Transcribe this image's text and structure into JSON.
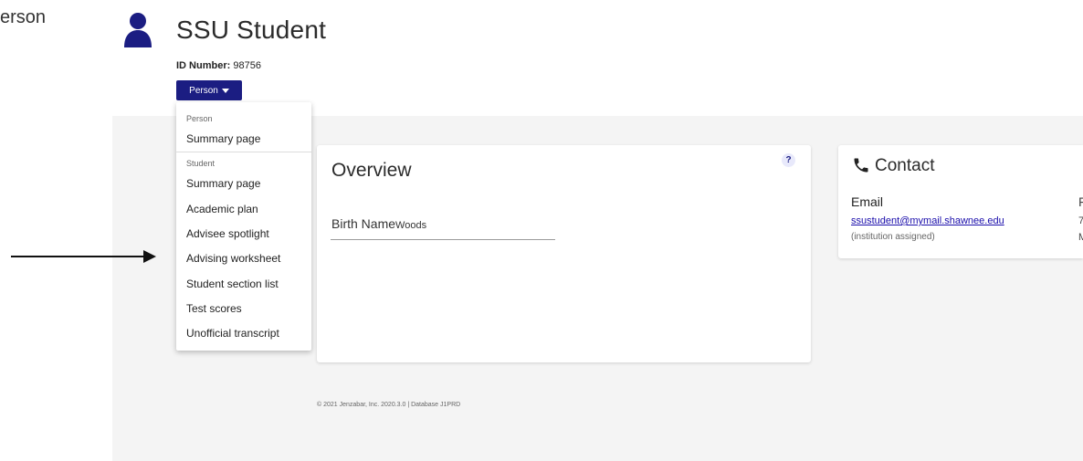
{
  "side_label": "erson",
  "header": {
    "title": "SSU Student",
    "id_label": "ID Number:",
    "id_value": "98756",
    "person_button_label": "Person"
  },
  "dropdown": {
    "group_person": "Person",
    "person_summary": "Summary page",
    "group_student": "Student",
    "items": [
      "Summary page",
      "Academic plan",
      "Advisee spotlight",
      "Advising worksheet",
      "Student section list",
      "Test scores",
      "Unofficial transcript"
    ]
  },
  "overview": {
    "title": "Overview",
    "help": "?",
    "birth_name_label": "Birth Name",
    "birth_name_value": "Woods"
  },
  "contact": {
    "title": "Contact",
    "email_label": "Email",
    "email_value": "ssustudent@mymail.shawnee.edu",
    "email_note": "(institution assigned)",
    "cutoff_1": "F",
    "cutoff_2": "7",
    "cutoff_3": "M"
  },
  "footer": {
    "text": "© 2021 Jenzabar, Inc.   2020.3.0 | Database J1PRD"
  },
  "colors": {
    "brand": "#1b1d82",
    "link": "#1a0dab",
    "background_panel": "#f4f4f4"
  }
}
